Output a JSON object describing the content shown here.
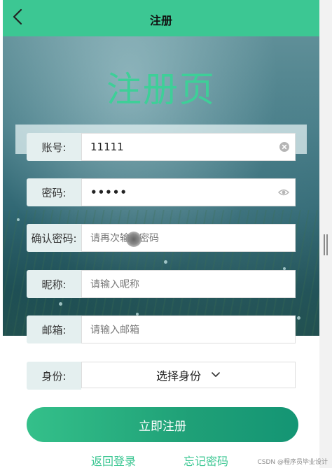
{
  "header": {
    "title": "注册"
  },
  "page_title": "注册页",
  "form": {
    "account": {
      "label": "账号:",
      "value": "11111",
      "placeholder": ""
    },
    "password": {
      "label": "密码:",
      "value": "•••••",
      "placeholder": ""
    },
    "confirm_password": {
      "label": "确认密码:",
      "placeholder": "请再次输入密码"
    },
    "nickname": {
      "label": "昵称:",
      "placeholder": "请输入昵称"
    },
    "email": {
      "label": "邮箱:",
      "placeholder": "请输入邮箱"
    },
    "identity": {
      "label": "身份:",
      "selected": "选择身份"
    }
  },
  "actions": {
    "register_label": "立即注册",
    "back_login_label": "返回登录",
    "forgot_password_label": "忘记密码"
  },
  "watermark": "CSDN @程序员毕业设计",
  "colors": {
    "brand_green": "#3cc793",
    "title_green": "#3ecf98",
    "button_start": "#34c08a",
    "button_end": "#149574"
  },
  "icons": [
    "back-arrow-icon",
    "clear-icon",
    "eye-icon",
    "chevron-down-icon"
  ]
}
